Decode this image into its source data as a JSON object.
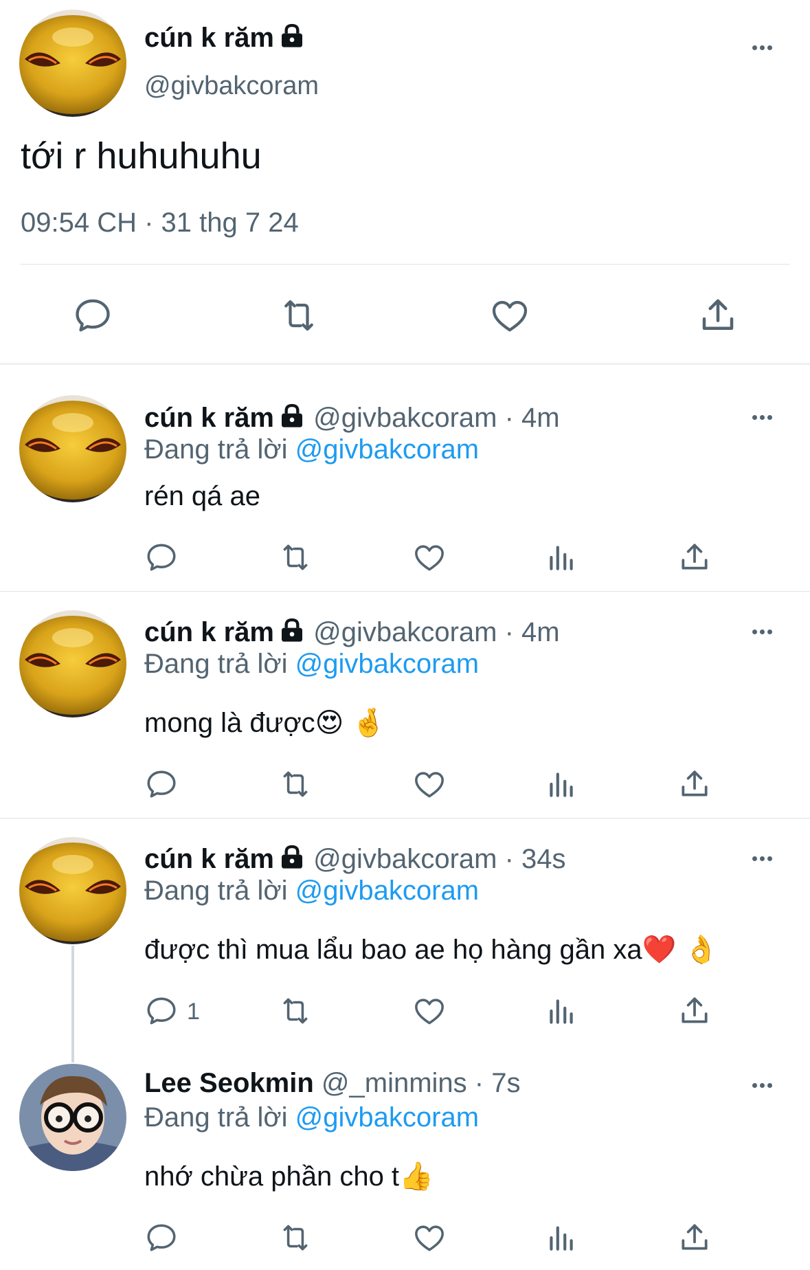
{
  "main_tweet": {
    "display_name": "cún k răm",
    "handle": "@givbakcoram",
    "text": "tới r huhuhuhu",
    "timestamp": "09:54 CH · 31 thg 7 24",
    "actions": [
      "reply-icon",
      "retweet-icon",
      "like-icon",
      "share-icon"
    ]
  },
  "replies": [
    {
      "display_name": "cún k răm",
      "handle": "@givbakcoram",
      "time": "· 4m",
      "replying_prefix": "Đang trả lời",
      "replying_to": "@givbakcoram",
      "text": "rén qá ae",
      "reply_count": ""
    },
    {
      "display_name": "cún k răm",
      "handle": "@givbakcoram",
      "time": "· 4m",
      "replying_prefix": "Đang trả lời",
      "replying_to": "@givbakcoram",
      "text": "mong là được😍 🤞",
      "reply_count": ""
    },
    {
      "display_name": "cún k răm",
      "handle": "@givbakcoram",
      "time": "· 34s",
      "replying_prefix": "Đang trả lời",
      "replying_to": "@givbakcoram",
      "text": "được thì mua lẩu bao ae họ hàng gần xa❤️ 👌",
      "reply_count": "1"
    },
    {
      "display_name": "Lee Seokmin",
      "handle": "@_minmins",
      "time": "· 7s",
      "replying_prefix": "Đang trả lời",
      "replying_to": "@givbakcoram",
      "text": "nhớ chừa phần cho t👍",
      "reply_count": ""
    }
  ],
  "colors": {
    "link": "#1d9bf0",
    "muted": "#536471",
    "divider": "#dfe3e6"
  }
}
